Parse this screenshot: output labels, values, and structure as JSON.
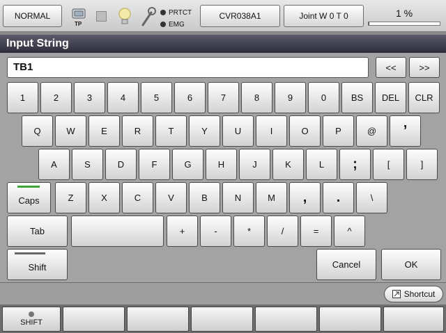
{
  "status": {
    "mode_label": "NORMAL",
    "tp_label": "TP",
    "prtct_label": "PRTCT",
    "emg_label": "EMG",
    "program_label": "CVR038A1",
    "joint_label": "Joint  W 0 T 0",
    "speed_label": "1 %",
    "speed_value": 0.01
  },
  "dialog": {
    "title": "Input String",
    "input_value": "TB1",
    "prev_label": "<<",
    "next_label": ">>"
  },
  "keyboard": {
    "row1": [
      "1",
      "2",
      "3",
      "4",
      "5",
      "6",
      "7",
      "8",
      "9",
      "0",
      "BS",
      "DEL",
      "CLR"
    ],
    "row2": [
      "Q",
      "W",
      "E",
      "R",
      "T",
      "Y",
      "U",
      "I",
      "O",
      "P",
      "@",
      "’"
    ],
    "row3": [
      "A",
      "S",
      "D",
      "F",
      "G",
      "H",
      "J",
      "K",
      "L",
      ";",
      "[",
      "]"
    ],
    "caps_label": "Caps",
    "row4": [
      "Z",
      "X",
      "C",
      "V",
      "B",
      "N",
      "M",
      ",",
      ".",
      "\\"
    ],
    "tab_label": "Tab",
    "row5": [
      "+",
      "-",
      "*",
      "/",
      "=",
      "^"
    ],
    "shift_label": "Shift",
    "cancel_label": "Cancel",
    "ok_label": "OK"
  },
  "shortcut_label": "Shortcut",
  "footer": {
    "shift_label": "SHIFT"
  },
  "colors": {
    "caps_indicator": "#3aa63a",
    "title_bar": "#3a3a4a"
  }
}
